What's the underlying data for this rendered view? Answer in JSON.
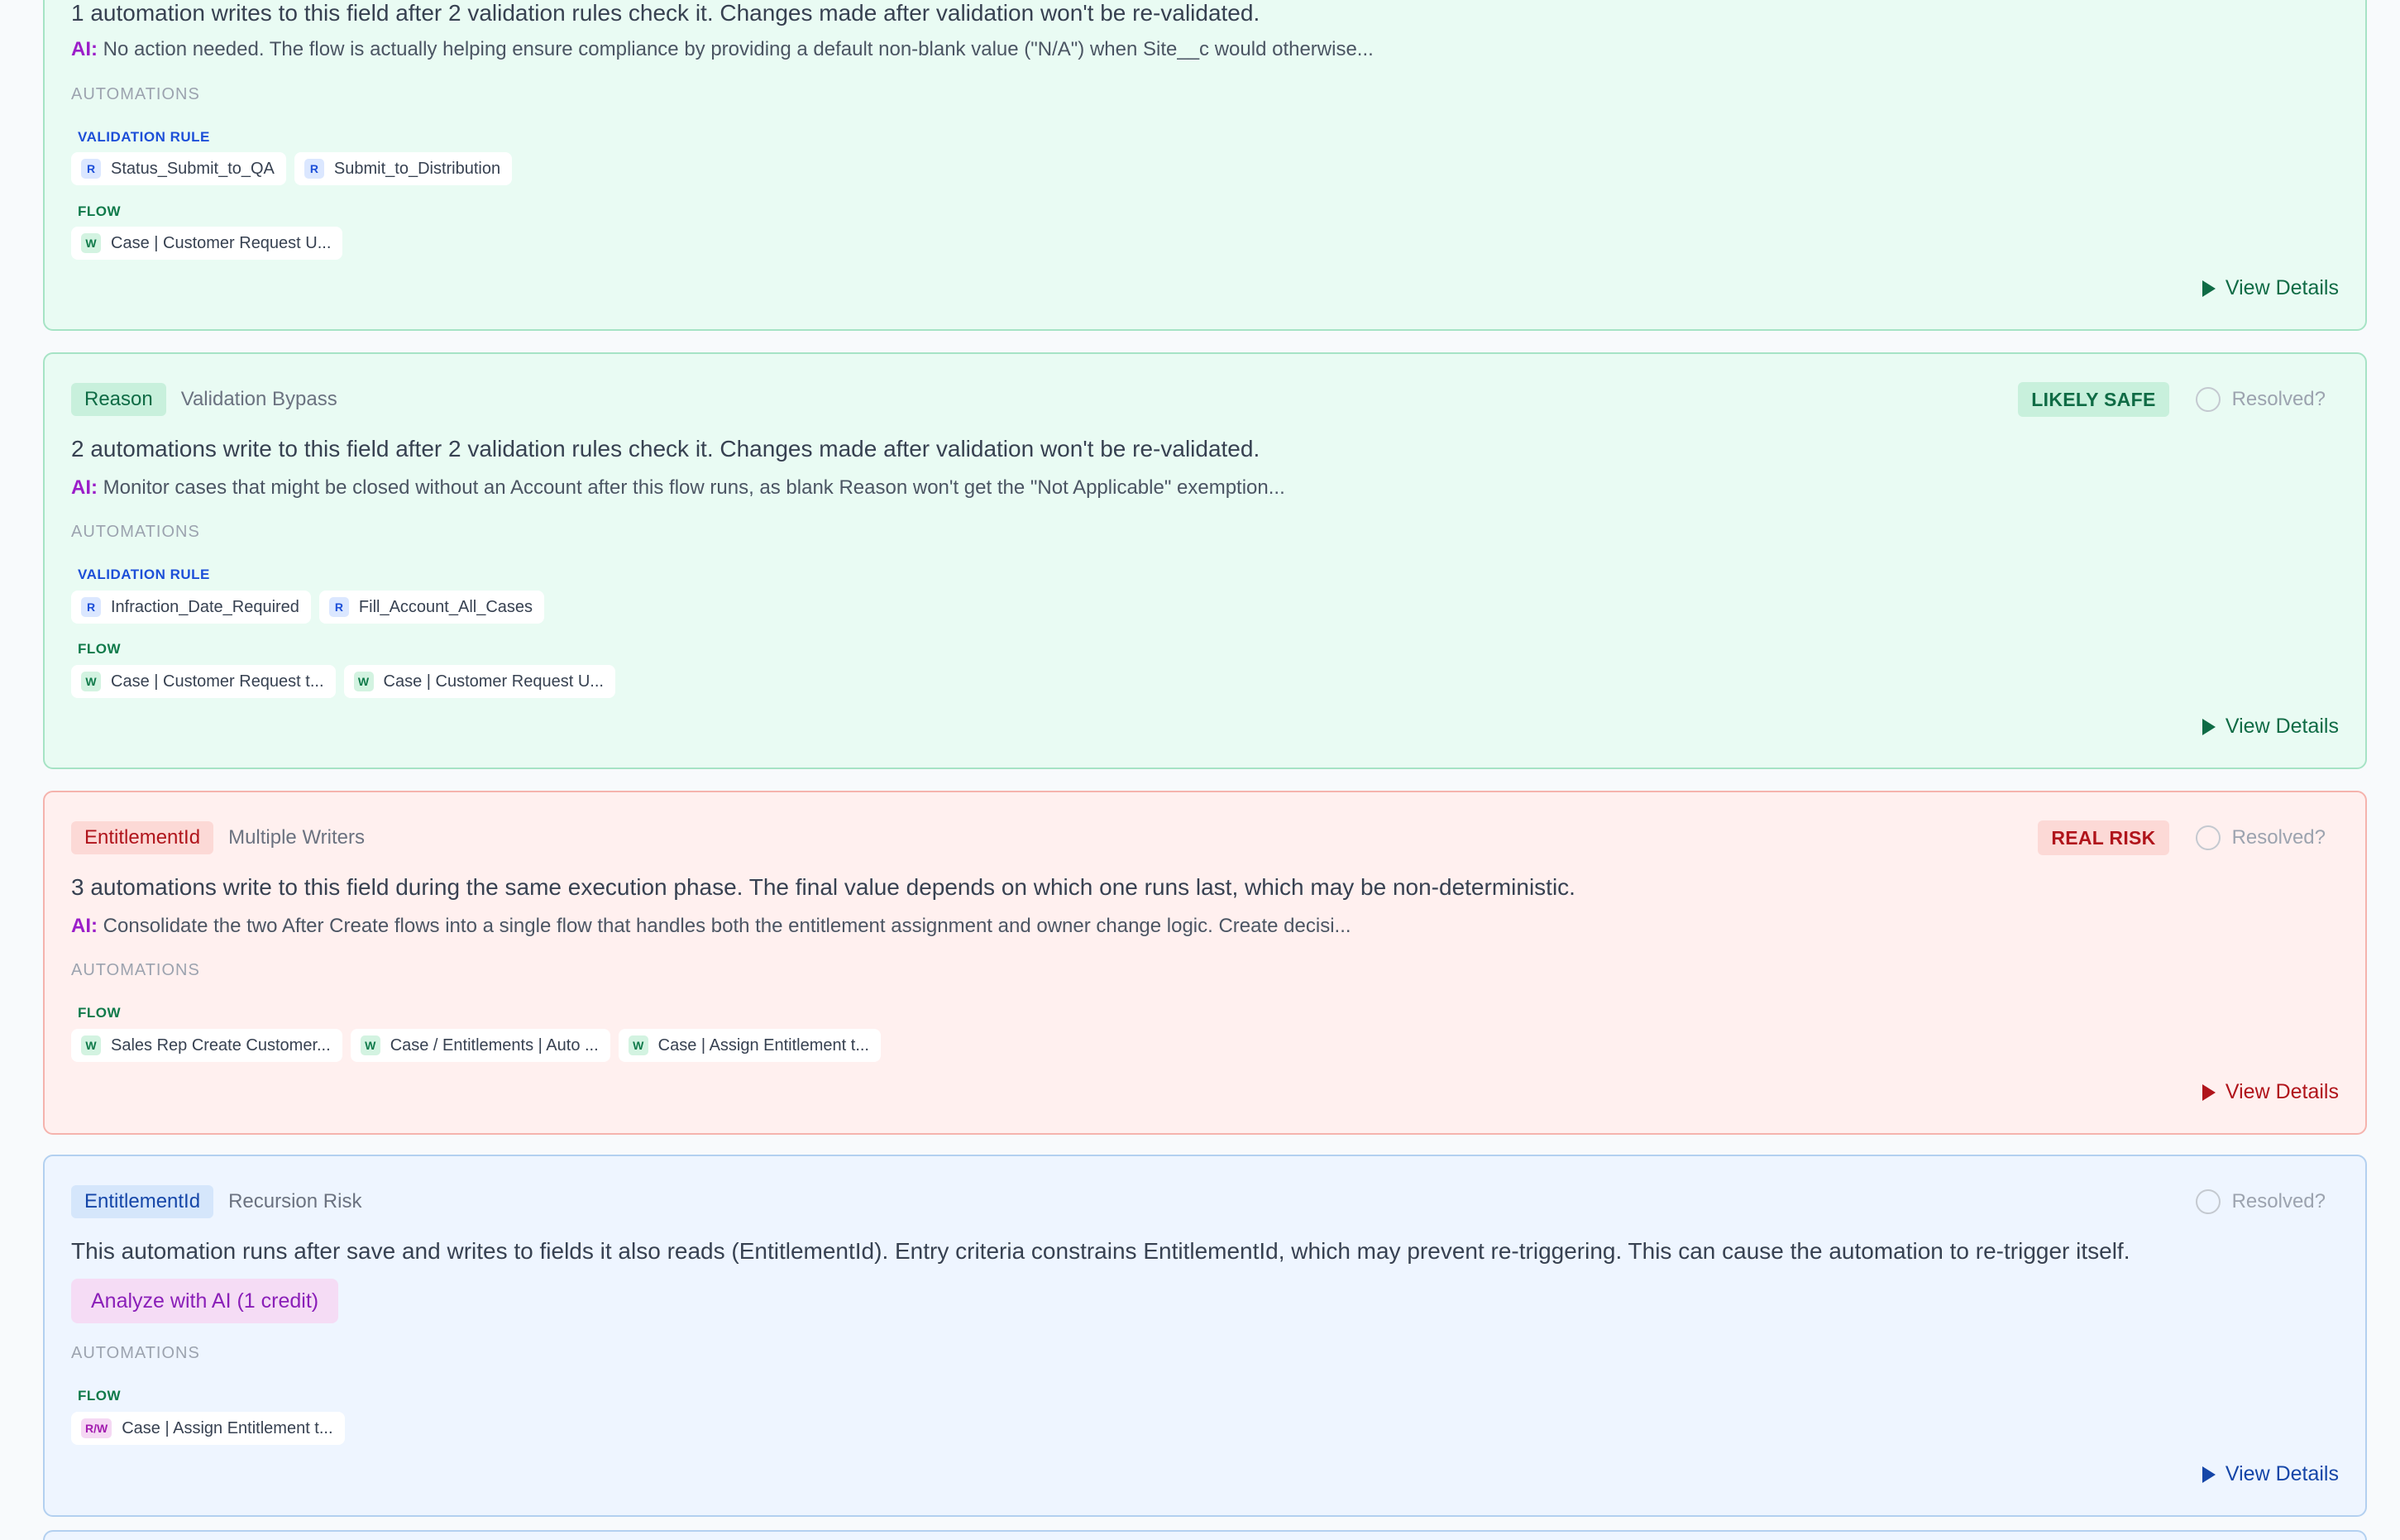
{
  "cards": [
    {
      "desc": "1 automation writes to this field after 2 validation rules check it. Changes made after validation won't be re-validated.",
      "ai_label": "AI:",
      "ai_text": "No action needed. The flow is actually helping ensure compliance by providing a default non-blank value (\"N/A\") when Site__c would otherwise...",
      "automations_label": "AUTOMATIONS",
      "groups": [
        {
          "label": "VALIDATION RULE",
          "chips": [
            {
              "icon": "R",
              "text": "Status_Submit_to_QA"
            },
            {
              "icon": "R",
              "text": "Submit_to_Distribution"
            }
          ]
        },
        {
          "label": "FLOW",
          "chips": [
            {
              "icon": "W",
              "text": "Case | Customer Request U..."
            }
          ]
        }
      ],
      "view_details": "View Details"
    },
    {
      "field": "Reason",
      "issue": "Validation Bypass",
      "badge": "LIKELY SAFE",
      "resolved": "Resolved?",
      "desc": "2 automations write to this field after 2 validation rules check it. Changes made after validation won't be re-validated.",
      "ai_label": "AI:",
      "ai_text": "Monitor cases that might be closed without an Account after this flow runs, as blank Reason won't get the \"Not Applicable\" exemption...",
      "automations_label": "AUTOMATIONS",
      "groups": [
        {
          "label": "VALIDATION RULE",
          "chips": [
            {
              "icon": "R",
              "text": "Infraction_Date_Required"
            },
            {
              "icon": "R",
              "text": "Fill_Account_All_Cases"
            }
          ]
        },
        {
          "label": "FLOW",
          "chips": [
            {
              "icon": "W",
              "text": "Case | Customer Request t..."
            },
            {
              "icon": "W",
              "text": "Case | Customer Request U..."
            }
          ]
        }
      ],
      "view_details": "View Details"
    },
    {
      "field": "EntitlementId",
      "issue": "Multiple Writers",
      "badge": "REAL RISK",
      "resolved": "Resolved?",
      "desc": "3 automations write to this field during the same execution phase. The final value depends on which one runs last, which may be non-deterministic.",
      "ai_label": "AI:",
      "ai_text": "Consolidate the two After Create flows into a single flow that handles both the entitlement assignment and owner change logic. Create decisi...",
      "automations_label": "AUTOMATIONS",
      "groups": [
        {
          "label": "FLOW",
          "chips": [
            {
              "icon": "W",
              "text": "Sales Rep Create Customer..."
            },
            {
              "icon": "W",
              "text": "Case / Entitlements | Auto ..."
            },
            {
              "icon": "W",
              "text": "Case | Assign Entitlement t..."
            }
          ]
        }
      ],
      "view_details": "View Details"
    },
    {
      "field": "EntitlementId",
      "issue": "Recursion Risk",
      "resolved": "Resolved?",
      "desc": "This automation runs after save and writes to fields it also reads (EntitlementId). Entry criteria constrains EntitlementId, which may prevent re-triggering. This can cause the automation to re-trigger itself.",
      "analyze_button": "Analyze with AI (1 credit)",
      "automations_label": "AUTOMATIONS",
      "groups": [
        {
          "label": "FLOW",
          "chips": [
            {
              "icon": "R/W",
              "text": "Case | Assign Entitlement t..."
            }
          ]
        }
      ],
      "view_details": "View Details"
    }
  ],
  "colors": {
    "safe_bg": "#e9fbf3",
    "risk_bg": "#fff0ef",
    "info_bg": "#eef5ff",
    "ai_label": "#9b1ec9"
  },
  "icons": [
    "radio-circle-icon",
    "play-triangle-icon"
  ]
}
